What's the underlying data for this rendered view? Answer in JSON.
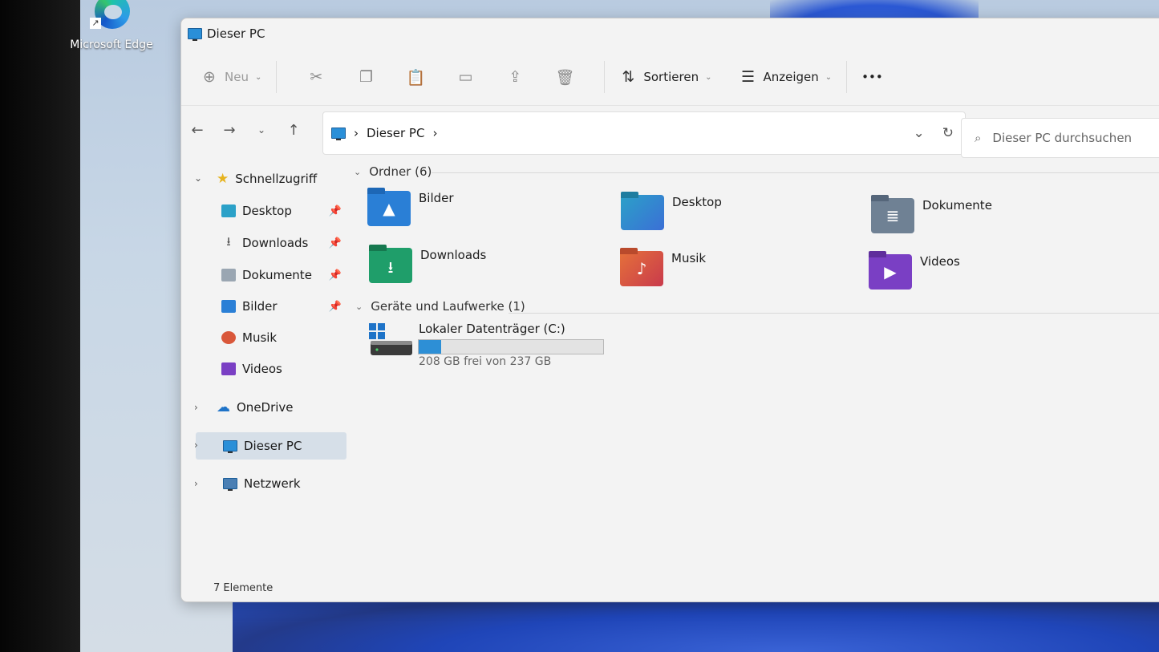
{
  "desktop": {
    "edge_label": "Microsoft Edge"
  },
  "window": {
    "title": "Dieser PC"
  },
  "toolbar": {
    "new_label": "Neu",
    "sort_label": "Sortieren",
    "view_label": "Anzeigen",
    "more_label": "•••"
  },
  "address": {
    "location": "Dieser PC",
    "search_placeholder": "Dieser PC durchsuchen"
  },
  "sidebar": {
    "quick_access": "Schnellzugriff",
    "items": [
      {
        "label": "Desktop"
      },
      {
        "label": "Downloads"
      },
      {
        "label": "Dokumente"
      },
      {
        "label": "Bilder"
      },
      {
        "label": "Musik"
      },
      {
        "label": "Videos"
      }
    ],
    "onedrive": "OneDrive",
    "this_pc": "Dieser PC",
    "network": "Netzwerk"
  },
  "folders_group": {
    "title": "Ordner (6)",
    "folders": [
      {
        "label": "Bilder",
        "color": "#2a7fd6"
      },
      {
        "label": "Desktop",
        "color": "#2ba1c8"
      },
      {
        "label": "Dokumente",
        "color": "#6f8194"
      },
      {
        "label": "Downloads",
        "color": "#1f9e6a"
      },
      {
        "label": "Musik",
        "color": "#d9573a"
      },
      {
        "label": "Videos",
        "color": "#7a3fc4"
      }
    ]
  },
  "drives_group": {
    "title": "Geräte und Laufwerke (1)",
    "drive": {
      "label": "Lokaler Datenträger (C:)",
      "free_text": "208 GB frei von 237 GB",
      "used_fraction": 0.12
    }
  },
  "status": {
    "count": "7 Elemente"
  }
}
